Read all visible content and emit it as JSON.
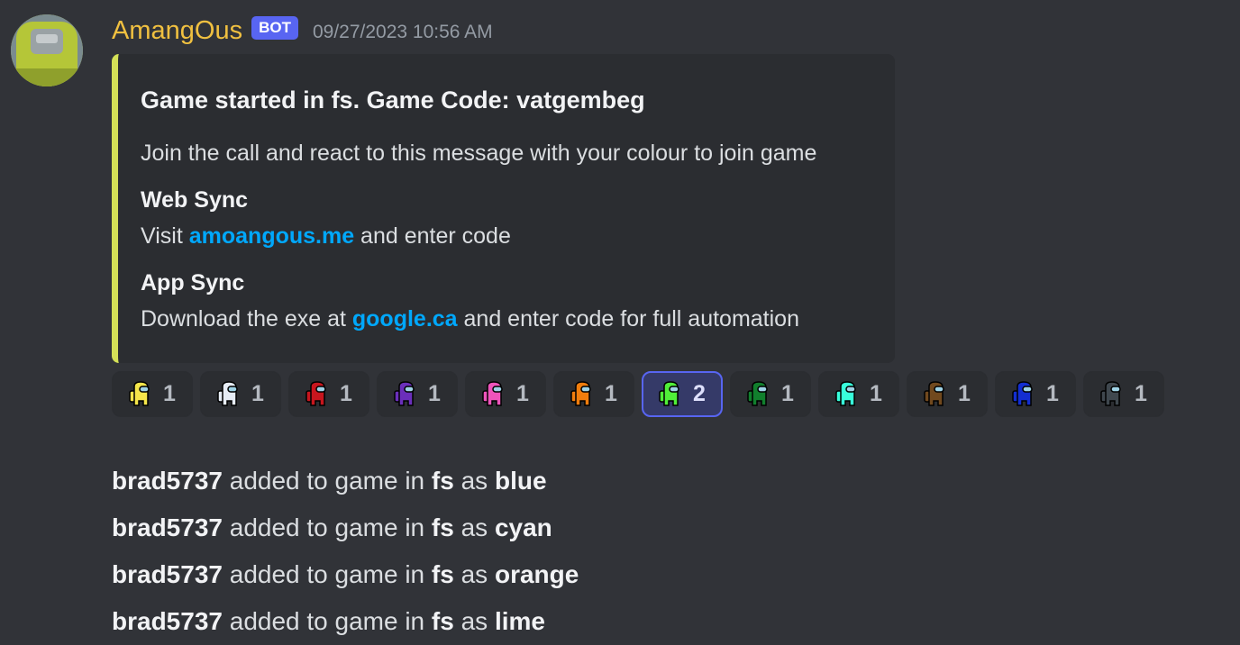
{
  "message": {
    "author": "AmangOus",
    "badge": "BOT",
    "timestamp": "09/27/2023 10:56 AM"
  },
  "embed": {
    "accent_color": "#d4e157",
    "title": "Game started in fs. Game Code: vatgembeg",
    "description": "Join the call and react to this message with your colour to join game",
    "fields": [
      {
        "name": "Web Sync",
        "prefix": "Visit ",
        "link": "amoangous.me",
        "suffix": " and enter code"
      },
      {
        "name": "App Sync",
        "prefix": "Download the exe at ",
        "link": "google.ca",
        "suffix": " and enter code for full automation"
      }
    ]
  },
  "reactions": [
    {
      "icon": "yellow-crewmate-icon",
      "color": "#f5e64b",
      "count": "1",
      "active": false
    },
    {
      "icon": "white-crewmate-icon",
      "color": "#e6ecf5",
      "count": "1",
      "active": false
    },
    {
      "icon": "red-crewmate-icon",
      "color": "#c8161e",
      "count": "1",
      "active": false
    },
    {
      "icon": "purple-crewmate-icon",
      "color": "#6b2fbb",
      "count": "1",
      "active": false
    },
    {
      "icon": "pink-crewmate-icon",
      "color": "#ee54bb",
      "count": "1",
      "active": false
    },
    {
      "icon": "orange-crewmate-icon",
      "color": "#f07d0d",
      "count": "1",
      "active": false
    },
    {
      "icon": "lime-crewmate-icon",
      "color": "#50ef39",
      "count": "2",
      "active": true
    },
    {
      "icon": "green-crewmate-icon",
      "color": "#117f2d",
      "count": "1",
      "active": false
    },
    {
      "icon": "cyan-crewmate-icon",
      "color": "#38fedb",
      "count": "1",
      "active": false
    },
    {
      "icon": "brown-crewmate-icon",
      "color": "#71491e",
      "count": "1",
      "active": false
    },
    {
      "icon": "blue-crewmate-icon",
      "color": "#132ed1",
      "count": "1",
      "active": false
    },
    {
      "icon": "black-crewmate-icon",
      "color": "#3f474e",
      "count": "1",
      "active": false
    }
  ],
  "log": [
    {
      "user": "brad5737",
      "mid": " added to game in ",
      "room": "fs",
      "as": " as ",
      "colour": "blue"
    },
    {
      "user": "brad5737",
      "mid": " added to game in ",
      "room": "fs",
      "as": " as ",
      "colour": "cyan"
    },
    {
      "user": "brad5737",
      "mid": " added to game in ",
      "room": "fs",
      "as": " as ",
      "colour": "orange"
    },
    {
      "user": "brad5737",
      "mid": " added to game in ",
      "room": "fs",
      "as": " as ",
      "colour": "lime"
    }
  ]
}
